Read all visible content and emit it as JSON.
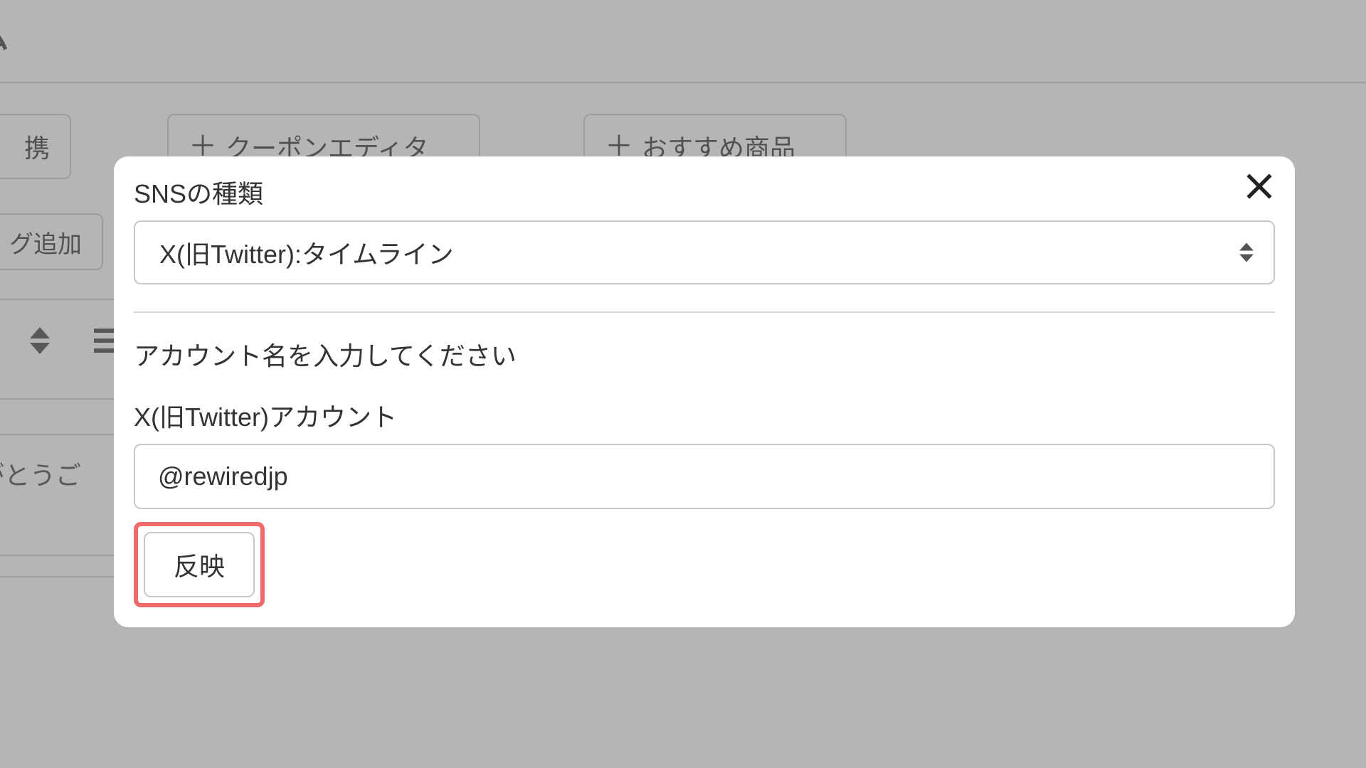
{
  "background": {
    "title_fragment": "ム",
    "btn_1_label": "携",
    "btn_2_label": "クーポンエディタ",
    "btn_3_label": "おすすめ商品",
    "btn_4_label": "グ追加",
    "text_fragment": "がとうご"
  },
  "modal": {
    "title": "SNSの種類",
    "select_value": "X(旧Twitter):タイムライン",
    "instruction": "アカウント名を入力してください",
    "field_label": "X(旧Twitter)アカウント",
    "account_value": "@rewiredjp",
    "apply_label": "反映"
  }
}
